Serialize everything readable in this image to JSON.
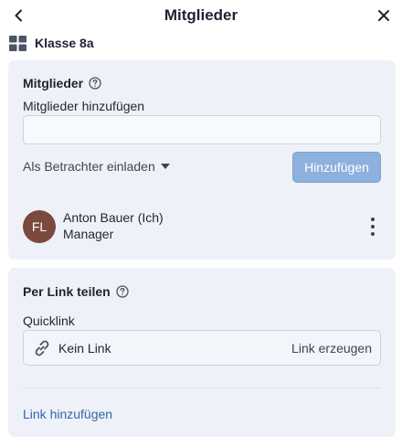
{
  "header": {
    "title": "Mitglieder",
    "back_icon": "chevron-left-icon",
    "close_icon": "close-icon"
  },
  "group": {
    "icon": "grid-icon",
    "name": "Klasse 8a"
  },
  "members_section": {
    "title": "Mitglieder",
    "add_label": "Mitglieder hinzufügen",
    "input_value": "",
    "input_placeholder": "",
    "role_selected": "Als Betrachter einladen",
    "add_button": "Hinzufügen",
    "members": [
      {
        "initials": "FL",
        "name": "Anton Bauer (Ich)",
        "role": "Manager",
        "avatar_color": "#7b4a3d"
      }
    ]
  },
  "link_section": {
    "title": "Per Link teilen",
    "quicklink_label": "Quicklink",
    "link_status": "Kein Link",
    "create_link": "Link erzeugen",
    "add_link": "Link hinzufügen"
  },
  "colors": {
    "card_bg": "#eef2f8",
    "accent": "#3565a8",
    "button_disabled": "#8eb0dc"
  }
}
